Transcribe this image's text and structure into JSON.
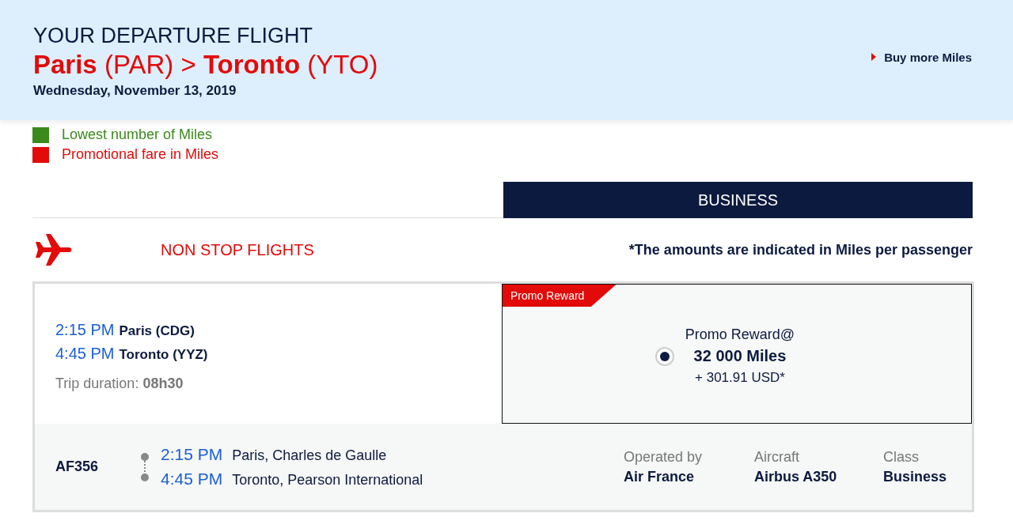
{
  "header": {
    "heading": "YOUR DEPARTURE FLIGHT",
    "route": "**Paris** (PAR) > **Toronto** (YTO)",
    "date": "Wednesday, November 13, 2019",
    "link": "Buy more Miles"
  },
  "legend": [
    {
      "label": "Lowest number of Miles",
      "color": "#3a8a1c"
    },
    {
      "label": "Promotional fare in Miles",
      "color": "#e30a0a"
    }
  ],
  "cabin": "BUSINESS",
  "section": {
    "title": "NON STOP FLIGHTS",
    "note": "*The amounts are indicated in Miles per passenger"
  },
  "flight": {
    "depart_time": "2:15 PM",
    "depart_place": "Paris (CDG)",
    "arrive_time": "4:45 PM",
    "arrive_place": "Toronto (YYZ)",
    "duration_label": "Trip duration:",
    "duration": "08h30",
    "fare": {
      "tag": "Promo Reward",
      "name": "Promo Reward@",
      "miles": "32 000 Miles",
      "tax": "+ 301.91 USD*",
      "selected": true
    },
    "segment": {
      "number": "AF356",
      "depart_time": "2:15 PM",
      "depart_place": "Paris, Charles de Gaulle",
      "arrive_time": "4:45 PM",
      "arrive_place": "Toronto, Pearson International",
      "details": [
        {
          "label": "Operated by",
          "value": "Air France"
        },
        {
          "label": "Aircraft",
          "value": "Airbus A350"
        },
        {
          "label": "Class",
          "value": "Business"
        }
      ]
    }
  }
}
